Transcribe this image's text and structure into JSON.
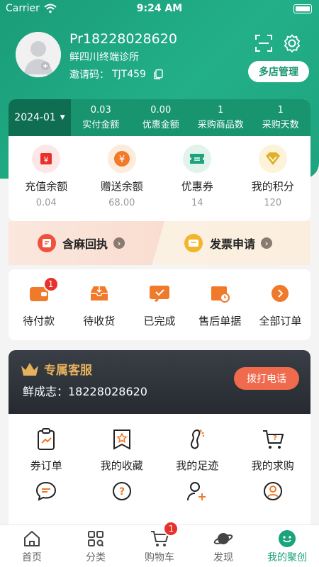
{
  "status_bar": {
    "carrier": "Carrier",
    "time": "9:24 AM"
  },
  "profile": {
    "name": "Pr18228028620",
    "clinic": "鲜四川终端诊所",
    "invite_label": "邀请码：",
    "invite_code": "TJT459",
    "multi_store_label": "多店管理"
  },
  "stats": {
    "month": "2024-01",
    "items": [
      {
        "value": "0.03",
        "label": "实付金额"
      },
      {
        "value": "0.00",
        "label": "优惠金额"
      },
      {
        "value": "1",
        "label": "采购商品数"
      },
      {
        "value": "1",
        "label": "采购天数"
      }
    ]
  },
  "assets": [
    {
      "label": "充值余额",
      "value": "0.04",
      "icon": "wallet-icon",
      "color": "#e8312b"
    },
    {
      "label": "赠送余额",
      "value": "68.00",
      "icon": "yen-icon",
      "color": "#f07a2a"
    },
    {
      "label": "优惠券",
      "value": "14",
      "icon": "coupon-icon",
      "color": "#1fa37f"
    },
    {
      "label": "我的积分",
      "value": "120",
      "icon": "diamond-icon",
      "color": "#e0b02a"
    }
  ],
  "promo": {
    "left_label": "含麻回执",
    "right_label": "发票申请"
  },
  "orders": [
    {
      "label": "待付款",
      "badge": "1"
    },
    {
      "label": "待收货"
    },
    {
      "label": "已完成"
    },
    {
      "label": "售后单据"
    },
    {
      "label": "全部订单"
    }
  ],
  "service": {
    "title": "专属客服",
    "contact": "鲜成志：18228028620",
    "call_label": "拨打电话"
  },
  "tools_row1": [
    {
      "label": "券订单",
      "icon": "ticket-order-icon"
    },
    {
      "label": "我的收藏",
      "icon": "star-bookmark-icon"
    },
    {
      "label": "我的足迹",
      "icon": "footprint-icon"
    },
    {
      "label": "我的求购",
      "icon": "cart-question-icon"
    }
  ],
  "tabs": [
    {
      "label": "首页",
      "icon": "home-icon"
    },
    {
      "label": "分类",
      "icon": "category-icon"
    },
    {
      "label": "购物车",
      "icon": "cart-icon",
      "badge": "1"
    },
    {
      "label": "发现",
      "icon": "planet-icon"
    },
    {
      "label": "我的聚创",
      "icon": "smile-icon",
      "active": true
    }
  ]
}
